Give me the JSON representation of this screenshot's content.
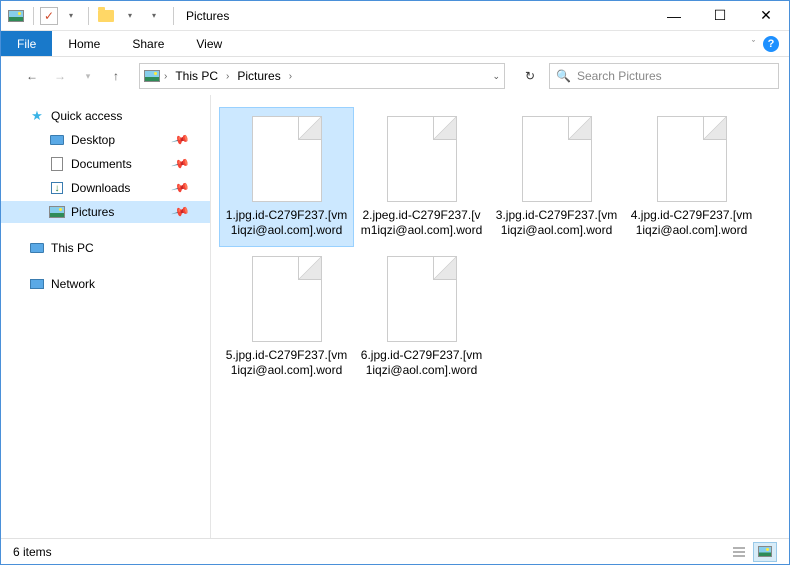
{
  "window": {
    "title": "Pictures"
  },
  "ribbon": {
    "file": "File",
    "tabs": [
      "Home",
      "Share",
      "View"
    ]
  },
  "breadcrumb": {
    "items": [
      "This PC",
      "Pictures"
    ]
  },
  "search": {
    "placeholder": "Search Pictures"
  },
  "sidebar": {
    "quick_access": {
      "label": "Quick access",
      "items": [
        {
          "label": "Desktop",
          "icon": "monitor",
          "pinned": true
        },
        {
          "label": "Documents",
          "icon": "doc",
          "pinned": true
        },
        {
          "label": "Downloads",
          "icon": "down",
          "pinned": true
        },
        {
          "label": "Pictures",
          "icon": "pic",
          "pinned": true,
          "selected": true
        }
      ]
    },
    "this_pc": {
      "label": "This PC"
    },
    "network": {
      "label": "Network"
    }
  },
  "files": [
    {
      "name": "1.jpg.id-C279F237.[vm1iqzi@aol.com].word",
      "selected": true
    },
    {
      "name": "2.jpeg.id-C279F237.[vm1iqzi@aol.com].word"
    },
    {
      "name": "3.jpg.id-C279F237.[vm1iqzi@aol.com].word"
    },
    {
      "name": "4.jpg.id-C279F237.[vm1iqzi@aol.com].word"
    },
    {
      "name": "5.jpg.id-C279F237.[vm1iqzi@aol.com].word"
    },
    {
      "name": "6.jpg.id-C279F237.[vm1iqzi@aol.com].word"
    }
  ],
  "status": {
    "count_label": "6 items"
  }
}
